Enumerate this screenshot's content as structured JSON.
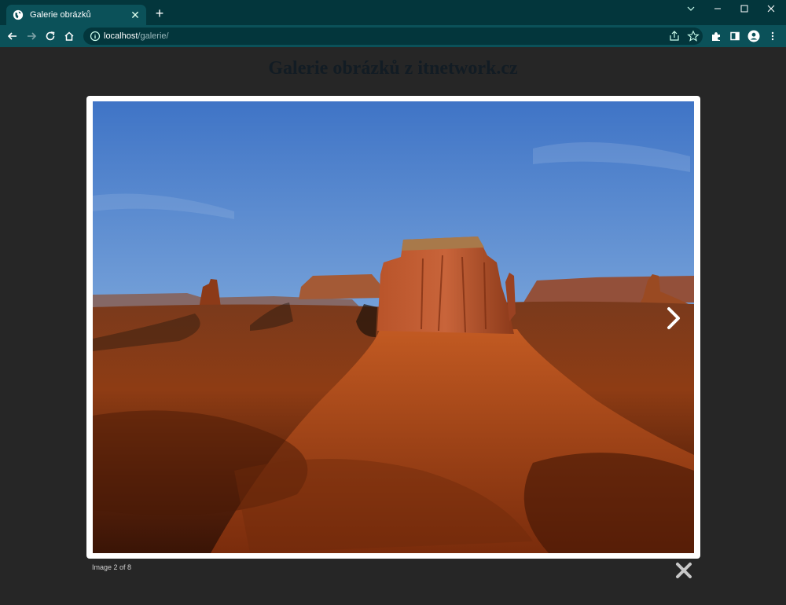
{
  "browser": {
    "tab": {
      "title": "Galerie obrázků",
      "favicon": "globe-icon"
    },
    "address": {
      "host": "localhost",
      "path": "/galerie/"
    },
    "colors": {
      "frame": "#03363c",
      "toolbar": "#0b5159"
    }
  },
  "page": {
    "title": "Galerie obrázků z itnetwork.cz"
  },
  "lightbox": {
    "caption": "Image 2 of 8",
    "image_alt": "desert-butte-photo",
    "current": 2,
    "total": 8
  }
}
